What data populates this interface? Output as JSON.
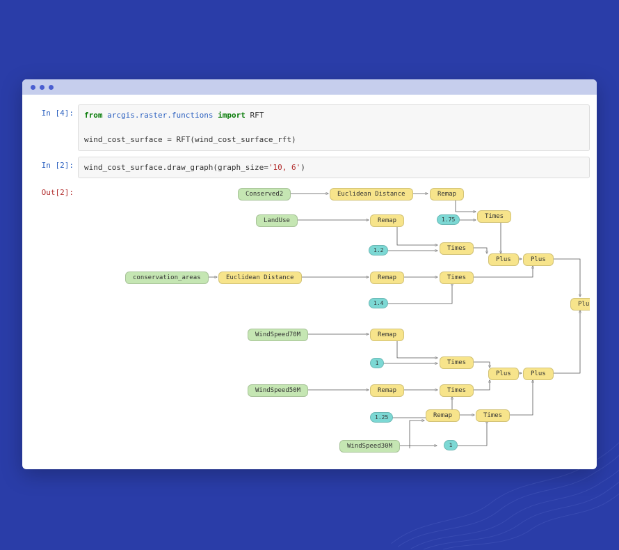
{
  "cells": {
    "in4_prompt": "In [4]:",
    "in4_kw_from": "from",
    "in4_mod": "arcgis.raster.functions",
    "in4_kw_import": "import",
    "in4_cls": "RFT",
    "in4_line2": "wind_cost_surface = RFT(wind_cost_surface_rft)",
    "in2_prompt": "In [2]:",
    "in2_call_pre": "wind_cost_surface.draw_graph(graph_size=",
    "in2_arg": "'10, 6'",
    "in2_call_post": ")",
    "out2_prompt": "Out[2]:"
  },
  "graph": {
    "conserved2": "Conserved2",
    "landuse": "LandUse",
    "conservation_areas": "conservation_areas",
    "windspeed70": "WindSpeed70M",
    "windspeed50": "WindSpeed50M",
    "windspeed30": "WindSpeed30M",
    "euclidean_distance": "Euclidean Distance",
    "remap": "Remap",
    "times": "Times",
    "plus": "Plus",
    "c175": "1.75",
    "c12": "1.2",
    "c14": "1.4",
    "c1a": "1",
    "c125": "1.25",
    "c1b": "1"
  }
}
